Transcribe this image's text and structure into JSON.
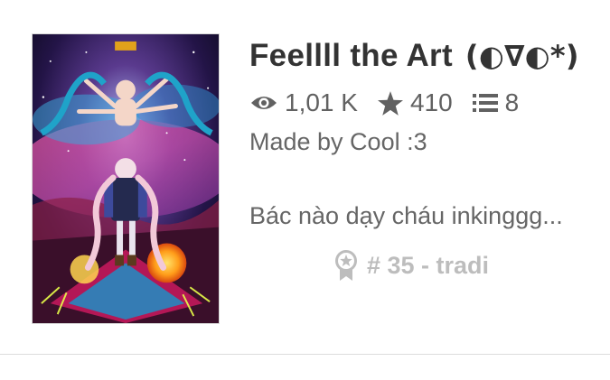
{
  "story": {
    "title": "Feellll the Art",
    "title_emoticon": "(◐∇◐*)",
    "stats": {
      "views": "1,01 K",
      "votes": "410",
      "parts": "8"
    },
    "author_line": "Made by Cool :3",
    "description": "Bác nào dạy cháu inkinggg...",
    "rank": "# 35 - tradi",
    "icons": {
      "views": "eye-icon",
      "votes": "star-icon",
      "parts": "list-icon",
      "rank": "ribbon-badge-icon"
    }
  },
  "colors": {
    "title": "#333333",
    "meta": "#616161",
    "rank": "#bdbdbd",
    "divider": "#dcdcdc"
  }
}
